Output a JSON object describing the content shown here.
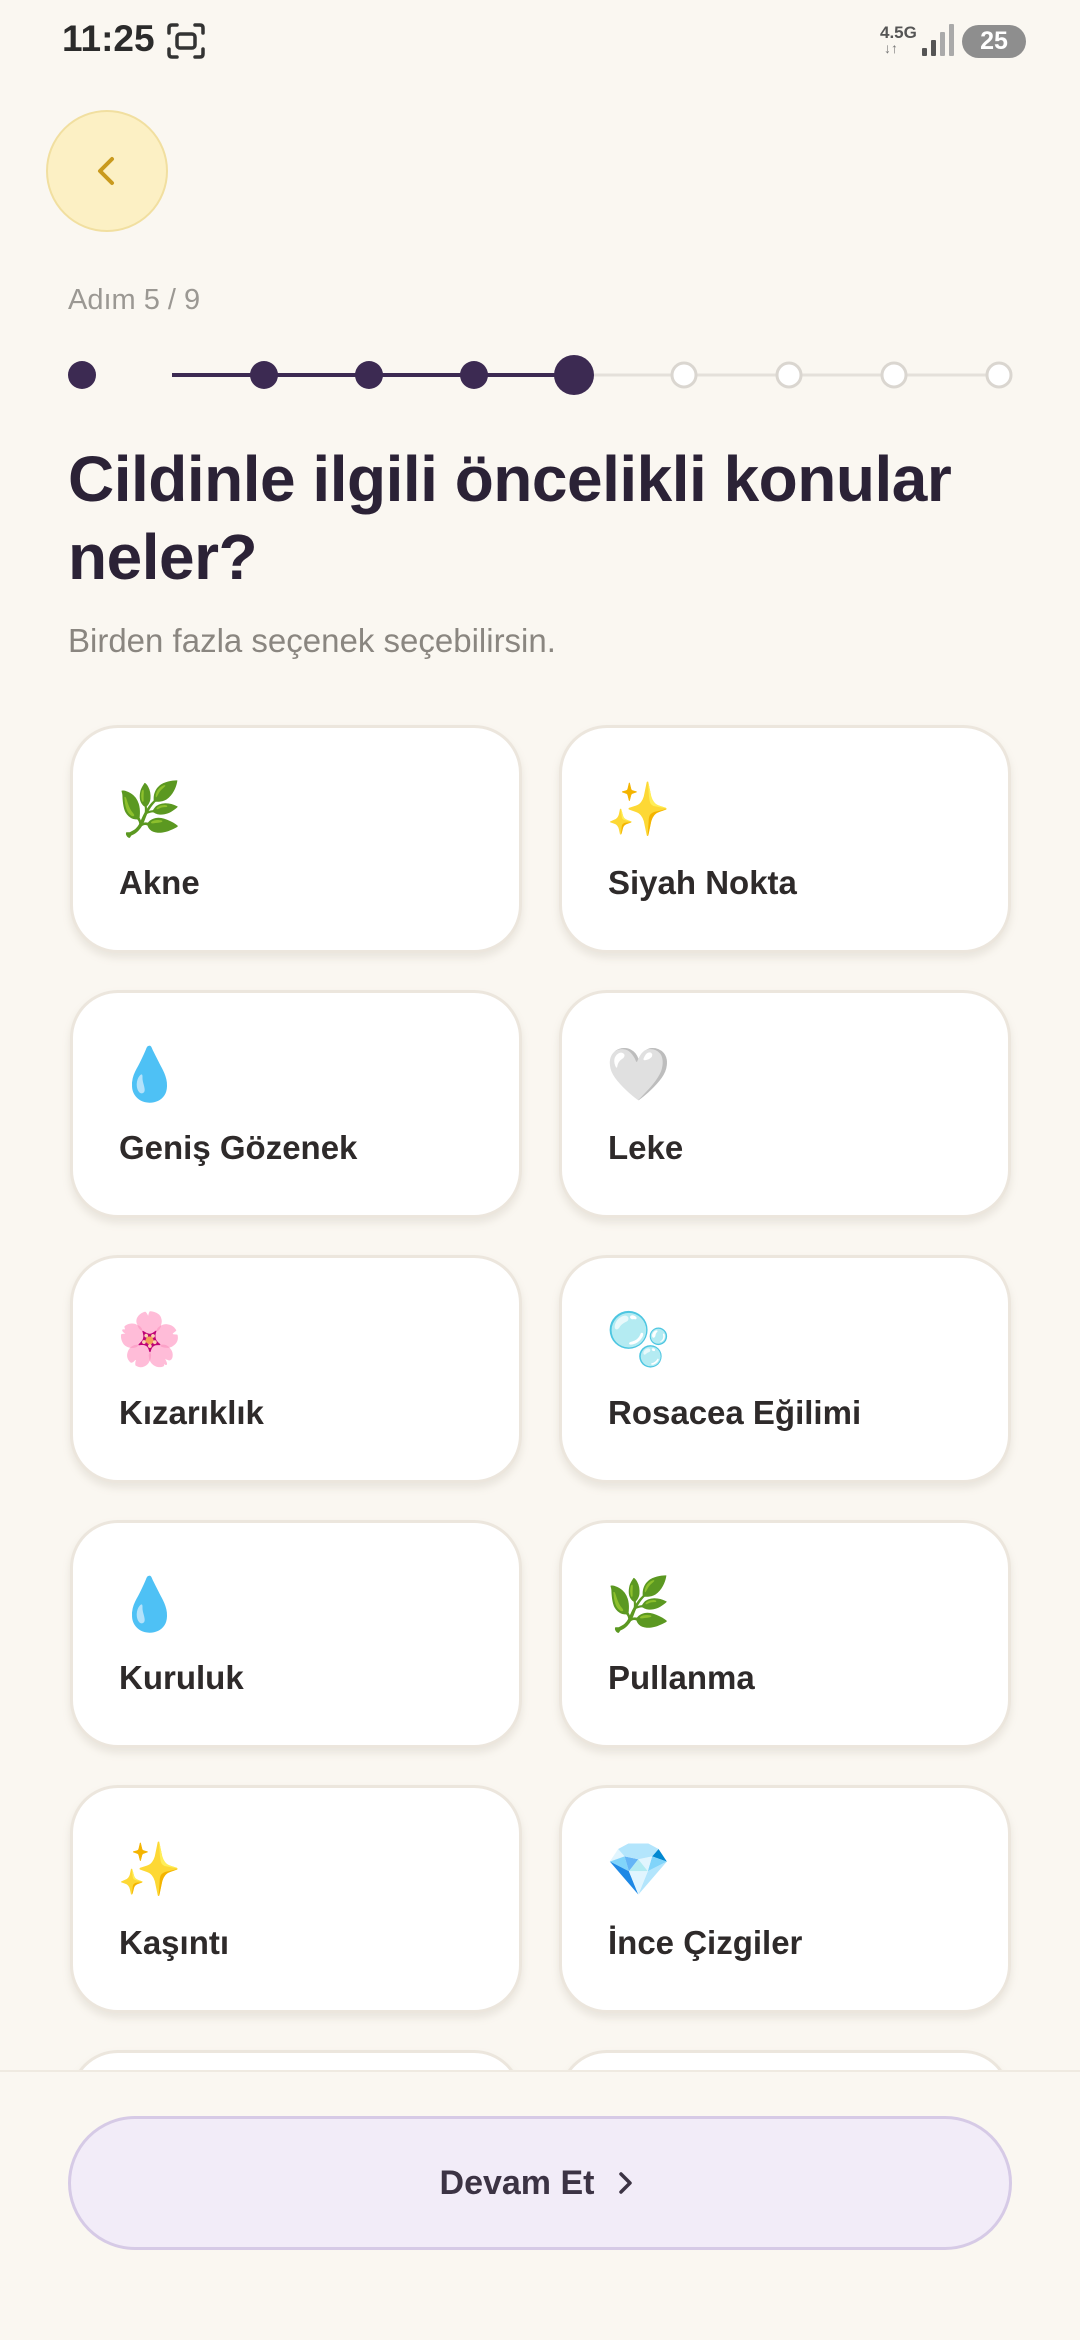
{
  "status_bar": {
    "time": "11:25",
    "network": "4.5G",
    "battery": "25"
  },
  "step_label": "Adım 5 / 9",
  "progress": {
    "current_step": 5,
    "total_steps": 9
  },
  "title": "Cildinle ilgili öncelikli konular neler?",
  "subtitle": "Birden fazla seçenek seçebilirsin.",
  "options": [
    {
      "label": "Akne",
      "emoji": "🌿"
    },
    {
      "label": "Siyah Nokta",
      "emoji": "✨"
    },
    {
      "label": "Geniş Gözenek",
      "emoji": "💧"
    },
    {
      "label": "Leke",
      "emoji": "🤍"
    },
    {
      "label": "Kızarıklık",
      "emoji": "🌸"
    },
    {
      "label": "Rosacea Eğilimi",
      "emoji": "🫧"
    },
    {
      "label": "Kuruluk",
      "emoji": "💧"
    },
    {
      "label": "Pullanma",
      "emoji": "🌿"
    },
    {
      "label": "Kaşıntı",
      "emoji": "✨"
    },
    {
      "label": "İnce Çizgiler",
      "emoji": "💎"
    }
  ],
  "continue_button": {
    "label": "Devam Et"
  },
  "colors": {
    "accent": "#3C2A52",
    "back_button_bg": "#FCF0C4",
    "back_chevron": "#C99A1E"
  }
}
